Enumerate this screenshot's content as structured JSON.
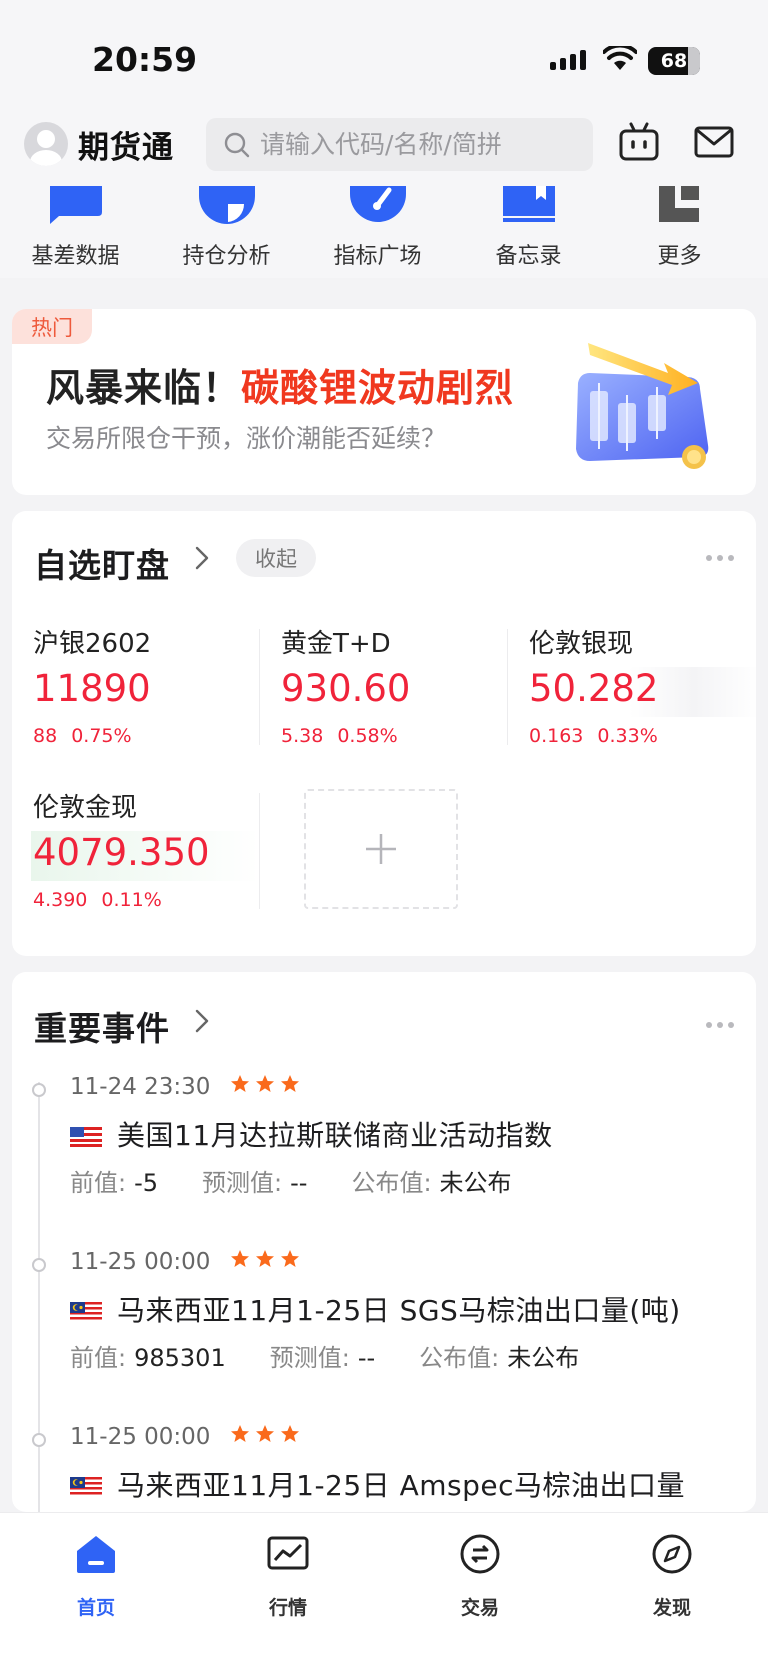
{
  "status_bar": {
    "time": "20:59",
    "battery": "68"
  },
  "top_bar": {
    "app_name": "期货通",
    "search_placeholder": "请输入代码/名称/简拼"
  },
  "shortcuts": [
    {
      "label": "基差数据",
      "icon": "chat-square-icon"
    },
    {
      "label": "持仓分析",
      "icon": "pie-chart-icon"
    },
    {
      "label": "指标广场",
      "icon": "gauge-icon"
    },
    {
      "label": "备忘录",
      "icon": "bookmark-book-icon"
    },
    {
      "label": "更多",
      "icon": "more-grid-icon"
    }
  ],
  "banner": {
    "badge": "热门",
    "headline_black": "风暴来临！",
    "headline_red": "碳酸锂波动剧烈",
    "subtitle": "交易所限仓干预，涨价潮能否延续？"
  },
  "watchlist": {
    "title": "自选盯盘",
    "collapse_label": "收起",
    "quotes": [
      {
        "name": "沪银2602",
        "price": "11890",
        "change": "88",
        "change_pct": "0.75%"
      },
      {
        "name": "黄金T+D",
        "price": "930.60",
        "change": "5.38",
        "change_pct": "0.58%"
      },
      {
        "name": "伦敦银现",
        "price": "50.282",
        "change": "0.163",
        "change_pct": "0.33%"
      },
      {
        "name": "伦敦金现",
        "price": "4079.350",
        "change": "4.390",
        "change_pct": "0.11%"
      }
    ]
  },
  "events": {
    "title": "重要事件",
    "items": [
      {
        "time": "11-24 23:30",
        "stars": 3,
        "flag": "us-flag-icon",
        "title": "美国11月达拉斯联储商业活动指数",
        "prev_label": "前值:",
        "prev": "-5",
        "forecast_label": "预测值:",
        "forecast": "--",
        "actual_label": "公布值:",
        "actual": "未公布"
      },
      {
        "time": "11-25 00:00",
        "stars": 3,
        "flag": "malaysia-flag-icon",
        "title": "马来西亚11月1-25日 SGS马棕油出口量(吨)",
        "prev_label": "前值:",
        "prev": "985301",
        "forecast_label": "预测值:",
        "forecast": "--",
        "actual_label": "公布值:",
        "actual": "未公布"
      },
      {
        "time": "11-25 00:00",
        "stars": 3,
        "flag": "malaysia-flag-icon",
        "title": "马来西亚11月1-25日 Amspec马棕油出口量",
        "prev_label": "",
        "prev": "",
        "forecast_label": "",
        "forecast": "",
        "actual_label": "",
        "actual": ""
      }
    ]
  },
  "tab_bar": [
    {
      "label": "首页",
      "icon": "home-icon",
      "active": true
    },
    {
      "label": "行情",
      "icon": "market-chart-icon",
      "active": false
    },
    {
      "label": "交易",
      "icon": "trade-icon",
      "active": false
    },
    {
      "label": "发现",
      "icon": "compass-icon",
      "active": false
    }
  ],
  "colors": {
    "accent_blue": "#2f63f5",
    "up_red": "#f0233a",
    "hot_orange": "#f0381f",
    "star_orange": "#fa6a1c"
  }
}
